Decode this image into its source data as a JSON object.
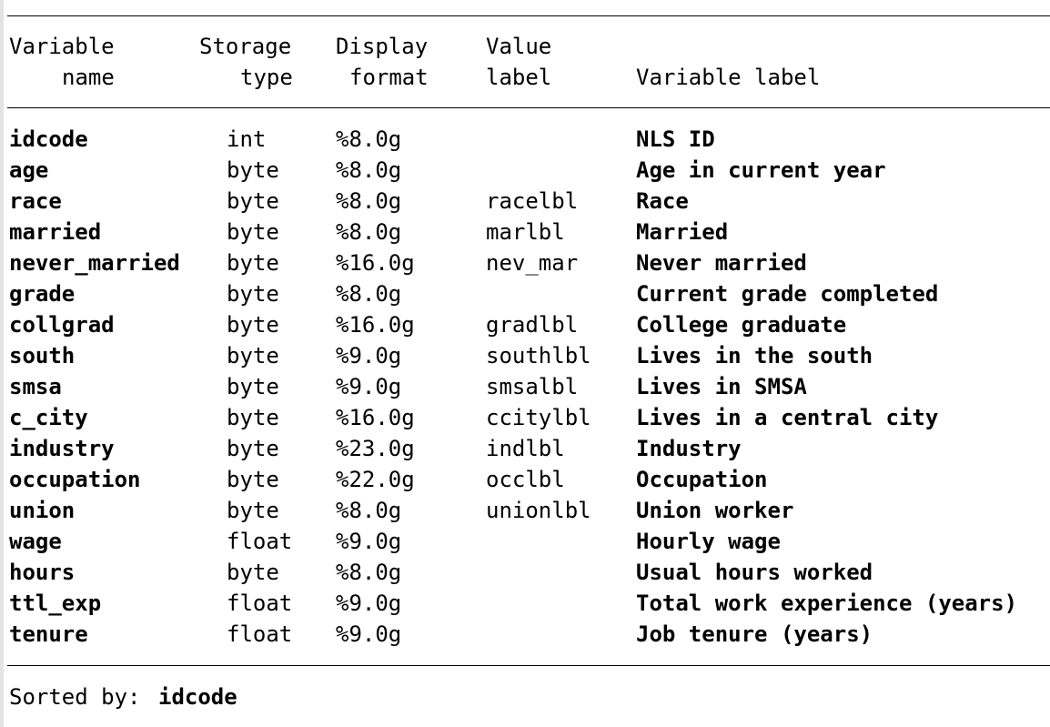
{
  "header": {
    "name_line1": "Variable",
    "name_line2": "name",
    "storage_line1": "Storage",
    "storage_line2": "type",
    "display_line1": "Display",
    "display_line2": "format",
    "value_line1": "Value",
    "value_line2": "label",
    "varlabel": "Variable label"
  },
  "rows": [
    {
      "name": "idcode",
      "type": "int",
      "format": "%8.0g",
      "value_label": "",
      "label": "NLS ID"
    },
    {
      "name": "age",
      "type": "byte",
      "format": "%8.0g",
      "value_label": "",
      "label": "Age in current year"
    },
    {
      "name": "race",
      "type": "byte",
      "format": "%8.0g",
      "value_label": "racelbl",
      "label": "Race"
    },
    {
      "name": "married",
      "type": "byte",
      "format": "%8.0g",
      "value_label": "marlbl",
      "label": "Married"
    },
    {
      "name": "never_married",
      "type": "byte",
      "format": "%16.0g",
      "value_label": "nev_mar",
      "label": "Never married"
    },
    {
      "name": "grade",
      "type": "byte",
      "format": "%8.0g",
      "value_label": "",
      "label": "Current grade completed"
    },
    {
      "name": "collgrad",
      "type": "byte",
      "format": "%16.0g",
      "value_label": "gradlbl",
      "label": "College graduate"
    },
    {
      "name": "south",
      "type": "byte",
      "format": "%9.0g",
      "value_label": "southlbl",
      "label": "Lives in the south"
    },
    {
      "name": "smsa",
      "type": "byte",
      "format": "%9.0g",
      "value_label": "smsalbl",
      "label": "Lives in SMSA"
    },
    {
      "name": "c_city",
      "type": "byte",
      "format": "%16.0g",
      "value_label": "ccitylbl",
      "label": "Lives in a central city"
    },
    {
      "name": "industry",
      "type": "byte",
      "format": "%23.0g",
      "value_label": "indlbl",
      "label": "Industry"
    },
    {
      "name": "occupation",
      "type": "byte",
      "format": "%22.0g",
      "value_label": "occlbl",
      "label": "Occupation"
    },
    {
      "name": "union",
      "type": "byte",
      "format": "%8.0g",
      "value_label": "unionlbl",
      "label": "Union worker"
    },
    {
      "name": "wage",
      "type": "float",
      "format": "%9.0g",
      "value_label": "",
      "label": "Hourly wage"
    },
    {
      "name": "hours",
      "type": "byte",
      "format": "%8.0g",
      "value_label": "",
      "label": "Usual hours worked"
    },
    {
      "name": "ttl_exp",
      "type": "float",
      "format": "%9.0g",
      "value_label": "",
      "label": "Total work experience (years)"
    },
    {
      "name": "tenure",
      "type": "float",
      "format": "%9.0g",
      "value_label": "",
      "label": "Job tenure (years)"
    }
  ],
  "footer": {
    "sorted_label": "Sorted by:",
    "sorted_value": "idcode"
  }
}
